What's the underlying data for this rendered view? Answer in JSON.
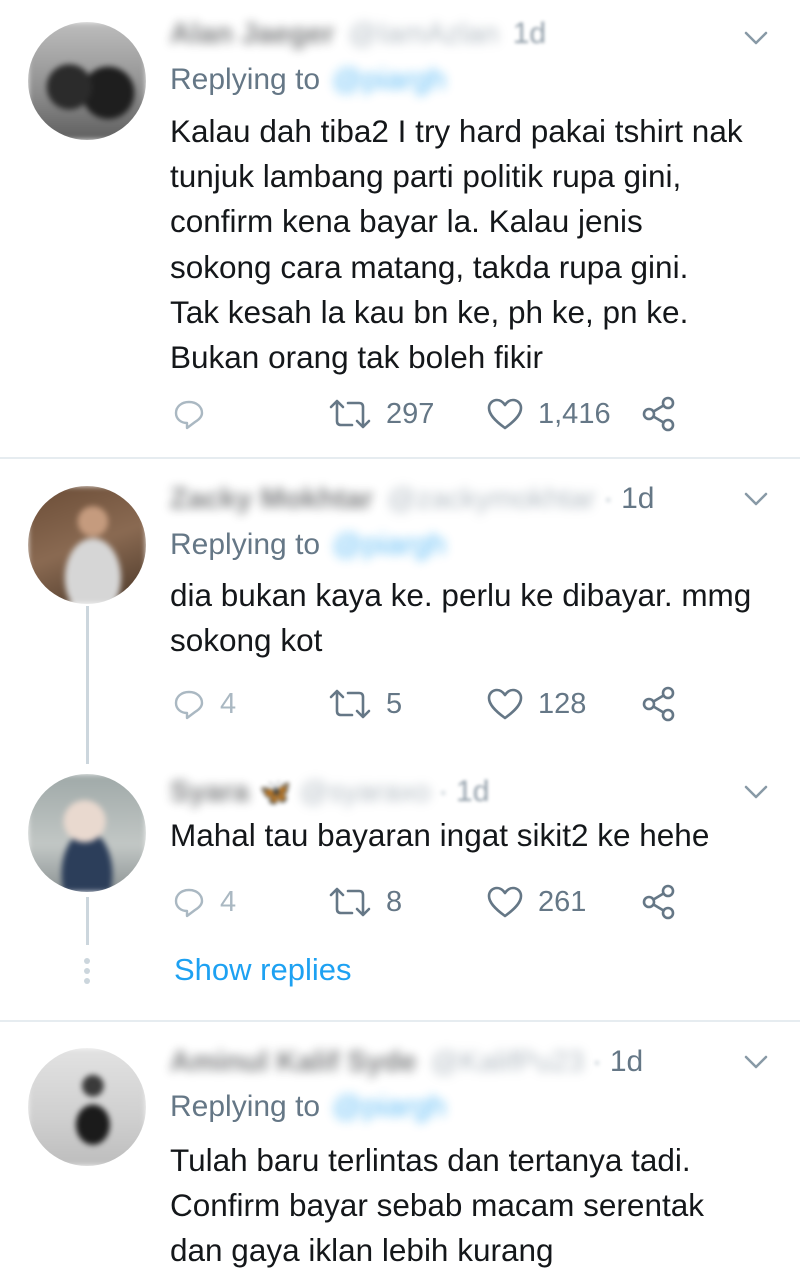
{
  "tweets": [
    {
      "name": "Alan Jaeger",
      "handle": "@IamAzlan",
      "time": "1d",
      "replying_label": "Replying to",
      "replying_handle": "@piargh",
      "text_lines": [
        "Kalau dah tiba2 I try hard pakai tshirt nak",
        "tunjuk lambang parti politik rupa gini,",
        "confirm kena bayar la. Kalau jenis",
        "sokong cara matang, takda rupa gini.",
        "Tak kesah la kau bn ke, ph ke, pn ke.",
        "Bukan orang tak boleh fikir"
      ],
      "reply_count": "",
      "retweet_count": "297",
      "like_count": "1,416"
    },
    {
      "name": "Zacky Mokhtar",
      "handle": "@zackymokhtar",
      "separator": "·",
      "time": "1d",
      "replying_label": "Replying to",
      "replying_handle": "@piargh",
      "text_lines": [
        "dia bukan kaya ke. perlu ke dibayar. mmg",
        "sokong kot"
      ],
      "reply_count": "4",
      "retweet_count": "5",
      "like_count": "128"
    },
    {
      "name": "Syara",
      "emoji": "🦋",
      "handle": "@syaraxo",
      "separator": "·",
      "time": "1d",
      "text_lines": [
        "Mahal tau bayaran ingat sikit2 ke hehe"
      ],
      "reply_count": "4",
      "retweet_count": "8",
      "like_count": "261"
    },
    {
      "name": "Aminul Kalif Syde",
      "handle": "@KalifPu23",
      "separator": "·",
      "time": "1d",
      "replying_label": "Replying to",
      "replying_handle": "@piargh",
      "text_lines": [
        "Tulah baru terlintas dan tertanya tadi.",
        "Confirm bayar sebab macam serentak",
        "dan gaya iklan lebih kurang"
      ]
    }
  ],
  "show_replies": "Show replies",
  "colors": {
    "accent": "#1da1f2",
    "secondary_text": "#657786",
    "divider": "#e6ecf0",
    "thread_line": "#ccd6dd"
  },
  "icons": [
    "reply-icon",
    "retweet-icon",
    "like-icon",
    "share-icon",
    "chevron-down-icon"
  ]
}
